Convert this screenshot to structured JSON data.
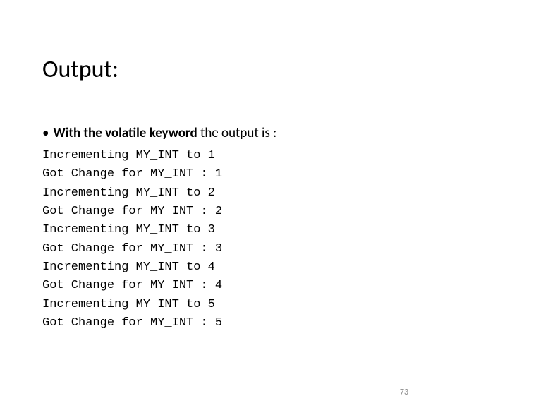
{
  "title": "Output:",
  "bullet_prefix": "•",
  "bullet_bold": "With the volatile keyword",
  "bullet_rest": " the output is :",
  "output_lines": [
    "Incrementing MY_INT to 1",
    "Got Change for MY_INT : 1",
    "Incrementing MY_INT to 2",
    "Got Change for MY_INT : 2",
    "Incrementing MY_INT to 3",
    "Got Change for MY_INT : 3",
    "Incrementing MY_INT to 4",
    "Got Change for MY_INT : 4",
    "Incrementing MY_INT to 5",
    "Got Change for MY_INT : 5"
  ],
  "page_number": "73"
}
